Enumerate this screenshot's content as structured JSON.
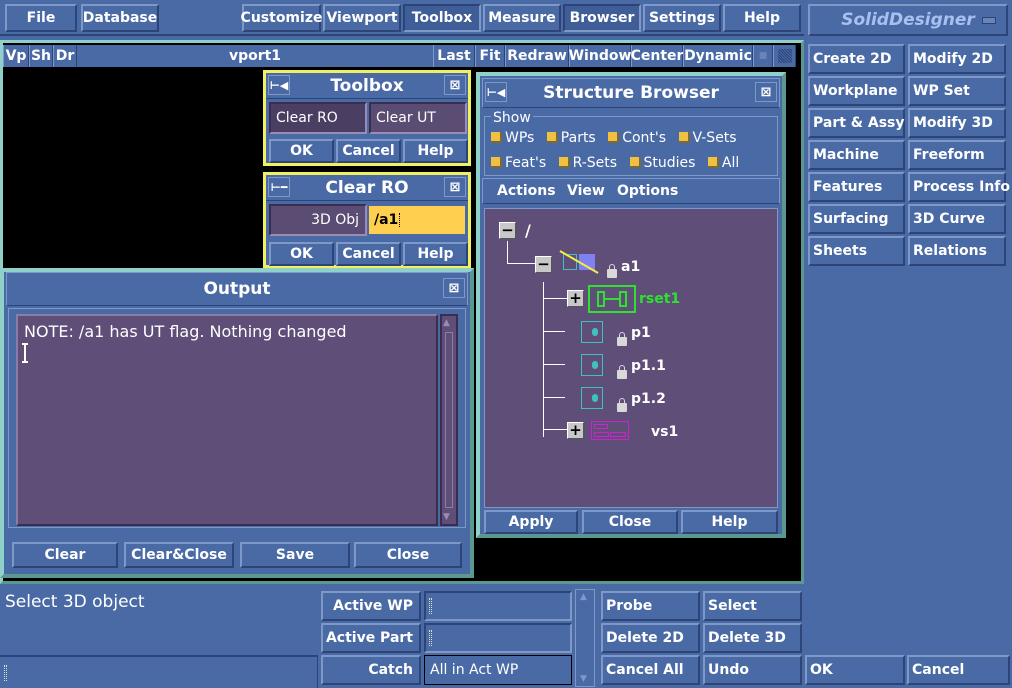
{
  "menubar": {
    "items": [
      "File",
      "Database",
      "Customize",
      "Viewport",
      "Toolbox",
      "Measure",
      "Browser",
      "Settings",
      "Help"
    ],
    "active": "Toolbox"
  },
  "app_panel": {
    "title": "SolidDesigner",
    "modules": [
      [
        "Create 2D",
        "Modify 2D"
      ],
      [
        "Workplane",
        "WP Set"
      ],
      [
        "Part & Assy",
        "Modify 3D"
      ],
      [
        "Machine",
        "Freeform"
      ],
      [
        "Features",
        "Process Info"
      ],
      [
        "Surfacing",
        "3D Curve"
      ],
      [
        "Sheets",
        "Relations"
      ]
    ]
  },
  "viewport": {
    "left_buttons": [
      "Vp",
      "Sh",
      "Dr"
    ],
    "name": "vport1",
    "right_buttons": [
      "Last",
      "Fit",
      "Redraw",
      "Window",
      "Center",
      "Dynamic"
    ]
  },
  "toolbox_dialog": {
    "title": "Toolbox",
    "options": [
      "Clear RO",
      "Clear UT"
    ],
    "buttons": [
      "OK",
      "Cancel",
      "Help"
    ]
  },
  "clear_ro_dialog": {
    "title": "Clear RO",
    "field_label": "3D Obj",
    "field_value": "/a1",
    "buttons": [
      "OK",
      "Cancel",
      "Help"
    ]
  },
  "output_window": {
    "title": "Output",
    "text": "NOTE: /a1 has UT flag. Nothing changed",
    "buttons": [
      "Clear",
      "Clear&Close",
      "Save",
      "Close"
    ]
  },
  "structure_browser": {
    "title": "Structure Browser",
    "show_label": "Show",
    "show_row1": [
      "WPs",
      "Parts",
      "Cont's",
      "V-Sets"
    ],
    "show_row2": [
      "Feat's",
      "R-Sets",
      "Studies",
      "All"
    ],
    "menu": [
      "Actions",
      "View",
      "Options"
    ],
    "tree": {
      "root": "/",
      "assembly": "a1",
      "children": [
        {
          "name": "rset1",
          "type": "rset",
          "expandable": true,
          "color": "#30e030"
        },
        {
          "name": "p1",
          "type": "part",
          "locked": true
        },
        {
          "name": "p1.1",
          "type": "part",
          "locked": true
        },
        {
          "name": "p1.2",
          "type": "part",
          "locked": true
        },
        {
          "name": "vs1",
          "type": "vset",
          "expandable": true,
          "color": "#d020d0"
        }
      ]
    },
    "buttons": [
      "Apply",
      "Close",
      "Help"
    ]
  },
  "prompt": {
    "text": "Select 3D object",
    "input_value": ""
  },
  "status_fields": [
    {
      "label": "Active WP",
      "value": ""
    },
    {
      "label": "Active Part",
      "value": ""
    },
    {
      "label": "Catch",
      "value": "All in Act WP"
    }
  ],
  "bottom_buttons": {
    "row1": [
      "Probe",
      "Select"
    ],
    "row2": [
      "Delete 2D",
      "Delete 3D"
    ],
    "row3": [
      "Cancel All",
      "Undo",
      "OK",
      "Cancel"
    ]
  },
  "colors": {
    "background": "#4a6aa6",
    "frame_teal": "#8fd0c8",
    "dialog_yellow": "#f0f060",
    "text_area": "#5e4e78",
    "input_highlight": "#ffd050"
  }
}
